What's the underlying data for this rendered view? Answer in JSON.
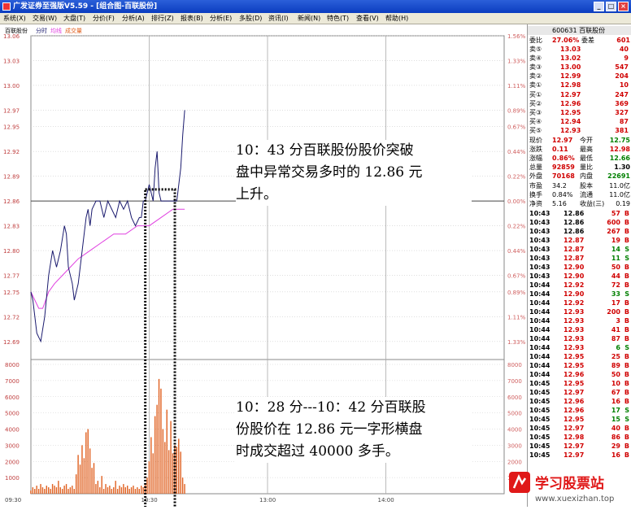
{
  "window": {
    "title": "广发证券至强版V5.59 - [组合图-百联股份]",
    "min": "_",
    "max": "□",
    "close": "×"
  },
  "menu": [
    "系统(X)",
    "交易(W)",
    "大盘(T)",
    "分价(F)",
    "分析(A)",
    "排行(Z)",
    "报表(B)",
    "分析(E)",
    "多股(D)",
    "资讯(I)",
    "新闻(N)",
    "特色(T)",
    "查看(V)",
    "帮助(H)"
  ],
  "chart_header": {
    "name": "百联股份",
    "time_label": "分时",
    "avg_label": "均线",
    "vol_label": "成交量"
  },
  "colors": {
    "price_line": "#1a1a6e",
    "avg_line": "#e040e0",
    "volume_bar": "#e06020",
    "up": "#d00000",
    "down": "#008000",
    "axis_text_left": "#c04040",
    "axis_text_right": "#d06060"
  },
  "price_axis": {
    "labels": [
      "13.06",
      "13.03",
      "13.00",
      "12.97",
      "12.95",
      "12.92",
      "12.89",
      "12.86",
      "12.83",
      "12.80",
      "12.77",
      "12.75",
      "12.72",
      "12.69"
    ],
    "pct": [
      "1.56%",
      "1.33%",
      "1.11%",
      "0.89%",
      "0.67%",
      "0.44%",
      "0.22%",
      "0.00%",
      "0.22%",
      "0.44%",
      "0.67%",
      "0.89%",
      "1.11%",
      "1.33%"
    ]
  },
  "volume_axis": {
    "labels": [
      "8000",
      "7000",
      "6000",
      "5000",
      "4000",
      "3000",
      "2000",
      "1000"
    ]
  },
  "time_axis": {
    "labels": [
      "09:30",
      "10:30",
      "13:00",
      "14:00"
    ]
  },
  "chart_data": {
    "type": "line",
    "x_unit": "minutes since 09:30",
    "ylim": [
      12.675,
      13.06
    ],
    "prev_close": 12.86,
    "price": [
      [
        0,
        12.75
      ],
      [
        1,
        12.74
      ],
      [
        3,
        12.7
      ],
      [
        5,
        12.69
      ],
      [
        7,
        12.72
      ],
      [
        9,
        12.77
      ],
      [
        11,
        12.8
      ],
      [
        13,
        12.78
      ],
      [
        15,
        12.8
      ],
      [
        17,
        12.83
      ],
      [
        18,
        12.82
      ],
      [
        19,
        12.78
      ],
      [
        21,
        12.76
      ],
      [
        22,
        12.74
      ],
      [
        24,
        12.76
      ],
      [
        26,
        12.8
      ],
      [
        28,
        12.84
      ],
      [
        29,
        12.85
      ],
      [
        30,
        12.83
      ],
      [
        31,
        12.85
      ],
      [
        33,
        12.86
      ],
      [
        35,
        12.86
      ],
      [
        37,
        12.84
      ],
      [
        39,
        12.86
      ],
      [
        41,
        12.85
      ],
      [
        43,
        12.84
      ],
      [
        45,
        12.86
      ],
      [
        47,
        12.85
      ],
      [
        49,
        12.86
      ],
      [
        51,
        12.84
      ],
      [
        53,
        12.83
      ],
      [
        55,
        12.84
      ],
      [
        56,
        12.84
      ],
      [
        57,
        12.86
      ],
      [
        58,
        12.86
      ],
      [
        60,
        12.88
      ],
      [
        61,
        12.87
      ],
      [
        62,
        12.86
      ],
      [
        63,
        12.9
      ],
      [
        64,
        12.92
      ],
      [
        65,
        12.87
      ],
      [
        66,
        12.86
      ],
      [
        68,
        12.86
      ],
      [
        70,
        12.86
      ],
      [
        72,
        12.86
      ],
      [
        74,
        12.86
      ],
      [
        75,
        12.88
      ],
      [
        76,
        12.9
      ],
      [
        77,
        12.94
      ],
      [
        78,
        12.97
      ]
    ],
    "avg": [
      [
        0,
        12.75
      ],
      [
        2,
        12.74
      ],
      [
        4,
        12.73
      ],
      [
        6,
        12.73
      ],
      [
        9,
        12.75
      ],
      [
        12,
        12.76
      ],
      [
        16,
        12.77
      ],
      [
        20,
        12.78
      ],
      [
        24,
        12.79
      ],
      [
        30,
        12.8
      ],
      [
        36,
        12.81
      ],
      [
        42,
        12.82
      ],
      [
        48,
        12.82
      ],
      [
        54,
        12.83
      ],
      [
        60,
        12.83
      ],
      [
        66,
        12.84
      ],
      [
        72,
        12.85
      ],
      [
        78,
        12.85
      ]
    ],
    "volume": [
      [
        0,
        200
      ],
      [
        1,
        400
      ],
      [
        2,
        300
      ],
      [
        3,
        500
      ],
      [
        4,
        300
      ],
      [
        5,
        600
      ],
      [
        6,
        400
      ],
      [
        7,
        300
      ],
      [
        8,
        500
      ],
      [
        9,
        400
      ],
      [
        10,
        300
      ],
      [
        11,
        600
      ],
      [
        12,
        500
      ],
      [
        13,
        400
      ],
      [
        14,
        800
      ],
      [
        15,
        400
      ],
      [
        16,
        300
      ],
      [
        17,
        500
      ],
      [
        18,
        600
      ],
      [
        19,
        300
      ],
      [
        20,
        400
      ],
      [
        21,
        500
      ],
      [
        22,
        300
      ],
      [
        23,
        1200
      ],
      [
        24,
        2400
      ],
      [
        25,
        1800
      ],
      [
        26,
        3000
      ],
      [
        27,
        2200
      ],
      [
        28,
        3800
      ],
      [
        29,
        4000
      ],
      [
        30,
        2800
      ],
      [
        31,
        1600
      ],
      [
        32,
        1900
      ],
      [
        33,
        600
      ],
      [
        34,
        800
      ],
      [
        35,
        400
      ],
      [
        36,
        1100
      ],
      [
        37,
        300
      ],
      [
        38,
        600
      ],
      [
        39,
        400
      ],
      [
        40,
        500
      ],
      [
        41,
        300
      ],
      [
        42,
        400
      ],
      [
        43,
        800
      ],
      [
        44,
        300
      ],
      [
        45,
        500
      ],
      [
        46,
        400
      ],
      [
        47,
        600
      ],
      [
        48,
        400
      ],
      [
        49,
        500
      ],
      [
        50,
        300
      ],
      [
        51,
        400
      ],
      [
        52,
        500
      ],
      [
        53,
        300
      ],
      [
        54,
        400
      ],
      [
        55,
        300
      ],
      [
        56,
        500
      ],
      [
        57,
        400
      ],
      [
        58,
        600
      ],
      [
        59,
        1000
      ],
      [
        60,
        2000
      ],
      [
        61,
        3500
      ],
      [
        62,
        2500
      ],
      [
        63,
        4800
      ],
      [
        64,
        5500
      ],
      [
        65,
        7100
      ],
      [
        66,
        6500
      ],
      [
        67,
        4000
      ],
      [
        68,
        3200
      ],
      [
        69,
        5200
      ],
      [
        70,
        2700
      ],
      [
        71,
        4500
      ],
      [
        72,
        2500
      ],
      [
        73,
        3000
      ],
      [
        74,
        2900
      ],
      [
        75,
        3400
      ],
      [
        76,
        2600
      ],
      [
        77,
        1000
      ],
      [
        78,
        600
      ]
    ]
  },
  "annotations": {
    "top": [
      "10：43 分百联股份股价突破",
      "盘中异常交易多时的 12.86 元",
      "上升。"
    ],
    "bottom": [
      "10：28 分---10：42 分百联股",
      "份股价在 12.86 元一字形横盘",
      "时成交超过 40000 多手。"
    ]
  },
  "panel": {
    "code_name": "600631 百联股份",
    "weibi": {
      "label": "委比",
      "value": "27.06%",
      "label2": "委差",
      "value2": "601"
    },
    "sell": [
      {
        "label": "卖⑤",
        "price": "13.03",
        "vol": "40"
      },
      {
        "label": "卖④",
        "price": "13.02",
        "vol": "9"
      },
      {
        "label": "卖③",
        "price": "13.00",
        "vol": "547"
      },
      {
        "label": "卖②",
        "price": "12.99",
        "vol": "204"
      },
      {
        "label": "卖①",
        "price": "12.98",
        "vol": "10"
      }
    ],
    "buy": [
      {
        "label": "买①",
        "price": "12.97",
        "vol": "247"
      },
      {
        "label": "买②",
        "price": "12.96",
        "vol": "369"
      },
      {
        "label": "买③",
        "price": "12.95",
        "vol": "327"
      },
      {
        "label": "买④",
        "price": "12.94",
        "vol": "87"
      },
      {
        "label": "买⑤",
        "price": "12.93",
        "vol": "381"
      }
    ],
    "stats": [
      {
        "l1": "现价",
        "v1": "12.97",
        "l2": "今开",
        "v2": "12.75"
      },
      {
        "l1": "涨跌",
        "v1": "0.11",
        "l2": "最高",
        "v2": "12.98"
      },
      {
        "l1": "涨幅",
        "v1": "0.86%",
        "l2": "最低",
        "v2": "12.66"
      },
      {
        "l1": "总量",
        "v1": "92859",
        "l2": "量比",
        "v2": "1.30"
      },
      {
        "l1": "外盘",
        "v1": "70168",
        "l2": "内盘",
        "v2": "22691"
      }
    ],
    "stats2": [
      {
        "l1": "市盈",
        "v1": "34.2",
        "l2": "股本",
        "v2": "11.0亿"
      },
      {
        "l1": "换手",
        "v1": "0.84%",
        "l2": "流通",
        "v2": "11.0亿"
      },
      {
        "l1": "净资",
        "v1": "5.16",
        "l2": "收益(三)",
        "v2": "0.19"
      }
    ],
    "ticks": [
      {
        "t": "10:43",
        "p": "12.86",
        "v": "57",
        "d": "B"
      },
      {
        "t": "10:43",
        "p": "12.86",
        "v": "600",
        "d": "B"
      },
      {
        "t": "10:43",
        "p": "12.86",
        "v": "267",
        "d": "B"
      },
      {
        "t": "10:43",
        "p": "12.87",
        "v": "19",
        "d": "B"
      },
      {
        "t": "10:43",
        "p": "12.87",
        "v": "14",
        "d": "S"
      },
      {
        "t": "10:43",
        "p": "12.87",
        "v": "11",
        "d": "S"
      },
      {
        "t": "10:43",
        "p": "12.90",
        "v": "50",
        "d": "B"
      },
      {
        "t": "10:43",
        "p": "12.90",
        "v": "44",
        "d": "B"
      },
      {
        "t": "10:44",
        "p": "12.92",
        "v": "72",
        "d": "B"
      },
      {
        "t": "10:44",
        "p": "12.90",
        "v": "33",
        "d": "S"
      },
      {
        "t": "10:44",
        "p": "12.92",
        "v": "17",
        "d": "B"
      },
      {
        "t": "10:44",
        "p": "12.93",
        "v": "200",
        "d": "B"
      },
      {
        "t": "10:44",
        "p": "12.93",
        "v": "3",
        "d": "B"
      },
      {
        "t": "10:44",
        "p": "12.93",
        "v": "41",
        "d": "B"
      },
      {
        "t": "10:44",
        "p": "12.93",
        "v": "87",
        "d": "B"
      },
      {
        "t": "10:44",
        "p": "12.93",
        "v": "6",
        "d": "S"
      },
      {
        "t": "10:44",
        "p": "12.95",
        "v": "25",
        "d": "B"
      },
      {
        "t": "10:44",
        "p": "12.95",
        "v": "89",
        "d": "B"
      },
      {
        "t": "10:44",
        "p": "12.96",
        "v": "50",
        "d": "B"
      },
      {
        "t": "10:45",
        "p": "12.95",
        "v": "10",
        "d": "B"
      },
      {
        "t": "10:45",
        "p": "12.97",
        "v": "67",
        "d": "B"
      },
      {
        "t": "10:45",
        "p": "12.96",
        "v": "16",
        "d": "B"
      },
      {
        "t": "10:45",
        "p": "12.96",
        "v": "17",
        "d": "S"
      },
      {
        "t": "10:45",
        "p": "12.95",
        "v": "15",
        "d": "S"
      },
      {
        "t": "10:45",
        "p": "12.97",
        "v": "40",
        "d": "B"
      },
      {
        "t": "10:45",
        "p": "12.98",
        "v": "86",
        "d": "B"
      },
      {
        "t": "10:45",
        "p": "12.97",
        "v": "29",
        "d": "B"
      },
      {
        "t": "10:45",
        "p": "12.97",
        "v": "16",
        "d": "B"
      }
    ]
  },
  "watermark": {
    "text": "学习股票站",
    "url": "www.xuexizhan.top"
  }
}
